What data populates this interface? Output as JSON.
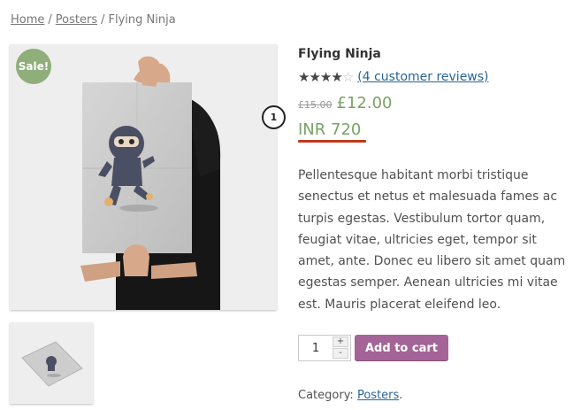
{
  "breadcrumb": {
    "home": "Home",
    "sep1": "/",
    "category": "Posters",
    "sep2": "/",
    "current": "Flying Ninja"
  },
  "gallery": {
    "sale_badge": "Sale!",
    "main_image_icon": "ninja-poster-image",
    "thumbnail_icon": "ninja-poster-thumbnail"
  },
  "product": {
    "title": "Flying Ninja",
    "rating": {
      "stars": [
        "★",
        "★",
        "★",
        "★",
        "☆"
      ],
      "value_out_of_5": 4,
      "reviews_label": "(4 customer reviews)"
    },
    "price": {
      "regular": "£15.00",
      "sale": "£12.00",
      "converted": "INR 720"
    },
    "annotation_marker": "1",
    "description": "Pellentesque habitant morbi tristique senectus et netus et malesuada fames ac turpis egestas. Vestibulum tortor quam, feugiat vitae, ultricies eget, tempor sit amet, ante. Donec eu libero sit amet quam egestas semper. Aenean ultricies mi vitae est. Mauris placerat eleifend leo.",
    "quantity": {
      "value": "1",
      "increment_label": "+",
      "decrement_label": "-"
    },
    "add_to_cart_label": "Add to cart",
    "category_prefix": "Category:",
    "category_link": "Posters",
    "category_suffix": "."
  },
  "colors": {
    "sale_green": "#77a464",
    "badge_green": "#8fae7a",
    "button_purple": "#a46497",
    "link_blue": "#2a6496",
    "underline_red": "#c0391b"
  }
}
